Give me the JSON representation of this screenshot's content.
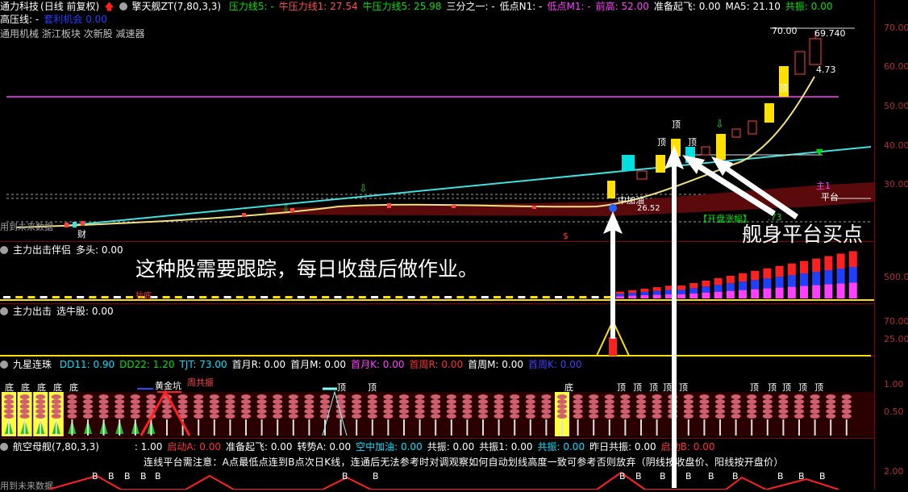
{
  "main": {
    "stock": "通力科技",
    "period": "(日线 前复权)",
    "indicator": "擎天舰ZT(7,80,3,3)",
    "items": [
      {
        "t": "压力线5: -",
        "c": "#00e000"
      },
      {
        "t": "牛压力线1: 27.54",
        "c": "#ff5050"
      },
      {
        "t": "牛压力线5: 25.98",
        "c": "#00e000"
      },
      {
        "t": "三分之一: -",
        "c": "#ffffff"
      },
      {
        "t": "低点N1: -",
        "c": "#ffffff"
      },
      {
        "t": "低点M1: -",
        "c": "#ff40ff"
      },
      {
        "t": "前高: 52.00",
        "c": "#ff40ff"
      },
      {
        "t": "准备起飞: 0.00",
        "c": "#ffffff"
      },
      {
        "t": "MA5: 21.10",
        "c": "#ffffff"
      },
      {
        "t": "共振: 0.00",
        "c": "#00e000"
      }
    ],
    "line2_label": "高压线: -",
    "line2_blue": "套利机会",
    "line2_val": "0.00",
    "sectors": "通用机械 浙江板块 次新股 减速器",
    "yticks": [
      "70.00",
      "60.00",
      "50.00",
      "40.00",
      "30.00"
    ],
    "price_high": "70.00",
    "price_high2": "69.740",
    "price_low_tag": "4.73",
    "mid_label": "中加油",
    "mid_val": "26.52",
    "cai_label": "财",
    "ding": [
      "顶",
      "顶",
      "顶",
      "顶"
    ],
    "zhu": "主1",
    "ping": "平台",
    "kaipan": "【开盘涨幅】",
    "kaipan_val": ".73",
    "future_label": "用到未来数据",
    "dollar": "$"
  },
  "pane2": {
    "title": "主力出击伴侣",
    "sub": "多头: 0.00",
    "ytick": "500.00",
    "small_label": "抄底"
  },
  "pane3": {
    "title": "主力出击",
    "sub": "选牛股: 0.00",
    "yticks": [
      "70.00",
      "25.00"
    ]
  },
  "pane4": {
    "title": "九星连珠",
    "items": [
      {
        "t": "DD11: 0.90",
        "c": "#00e0ff"
      },
      {
        "t": "DD22: 1.20",
        "c": "#00e000"
      },
      {
        "t": "TJT: 73.00",
        "c": "#00e0ff"
      },
      {
        "t": "首月R: 0.00",
        "c": "#ffffff"
      },
      {
        "t": "首月M: 0.00",
        "c": "#ffffff"
      },
      {
        "t": "首月K: 0.00",
        "c": "#ff40ff"
      },
      {
        "t": "首周R: 0.00",
        "c": "#ff3030"
      },
      {
        "t": "首周M: 0.00",
        "c": "#ffffff"
      },
      {
        "t": "首周K: 0.00",
        "c": "#4040ff"
      }
    ],
    "yticks": [
      "1.00",
      "0.50"
    ],
    "di_labels": [
      "底",
      "底",
      "底",
      "底",
      "底"
    ],
    "hj": "黄金坑",
    "gz": "周共振",
    "di2": "底",
    "xiang": "顶"
  },
  "pane5": {
    "title": "航空母舰(7,80,3,3)",
    "items": [
      {
        "t": ": 1.00",
        "c": "#ffffff"
      },
      {
        "t": "启动A: 0.00",
        "c": "#ff3030"
      },
      {
        "t": "准备起飞: 0.00",
        "c": "#ffffff"
      },
      {
        "t": "转势A: 0.00",
        "c": "#ffffff"
      },
      {
        "t": "空中加油: 0.00",
        "c": "#00e0ff"
      },
      {
        "t": "共振: 0.00",
        "c": "#ffffff"
      },
      {
        "t": "共振1: 0.00",
        "c": "#ffffff"
      },
      {
        "t": "共振: 0.00",
        "c": "#00e0ff"
      },
      {
        "t": "昨日共振: 0.00",
        "c": "#ffffff"
      },
      {
        "t": "启动B: 0.00",
        "c": "#ff3030"
      }
    ],
    "note": "连线平台需注意：A点最低点连到B点次日K线，连通后无法参考时对调观察如何自动划线高度一致可参考否则放弃（阴线按收盘价、阳线按开盘价）",
    "future_label": "用到未来数据",
    "ytick": "2.00",
    "b": "B"
  },
  "annotations": {
    "track": "这种股需要跟踪，每日收盘后做作业。",
    "buy": "舰身平台买点"
  }
}
